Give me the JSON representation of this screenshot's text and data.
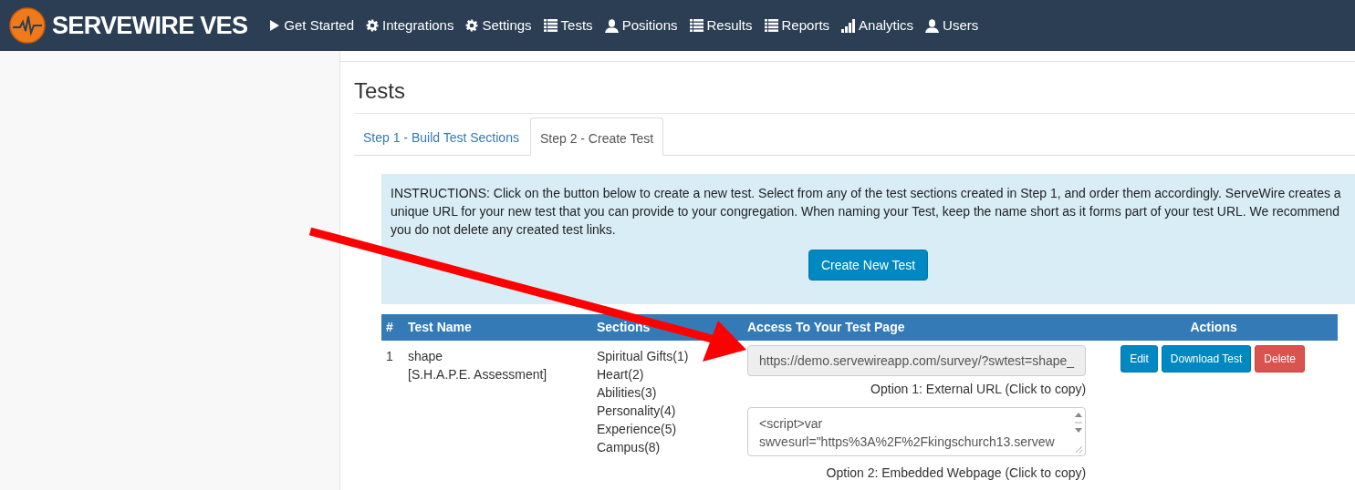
{
  "navbar": {
    "brand": "SERVEWIRE VES",
    "items": [
      {
        "label": "Get Started",
        "kind": "play"
      },
      {
        "label": "Integrations",
        "kind": "gear"
      },
      {
        "label": "Settings",
        "kind": "gear"
      },
      {
        "label": "Tests",
        "kind": "list"
      },
      {
        "label": "Positions",
        "kind": "user"
      },
      {
        "label": "Results",
        "kind": "list"
      },
      {
        "label": "Reports",
        "kind": "list"
      },
      {
        "label": "Analytics",
        "kind": "bars"
      },
      {
        "label": "Users",
        "kind": "user"
      }
    ]
  },
  "page": {
    "title": "Tests",
    "tabs": [
      {
        "label": "Step 1 - Build Test Sections",
        "selected": false
      },
      {
        "label": "Step 2 - Create Test",
        "selected": true
      }
    ],
    "instructions": "INSTRUCTIONS: Click on the button below to create a new test. Select from any of the test sections created in Step 1, and order them accordingly. ServeWire creates a unique URL for your new test that you can provide to your congregation. When naming your Test, keep the name short as it forms part of your test URL. We recommend you do not delete any created test links.",
    "create_button": "Create New Test",
    "table": {
      "columns": [
        "#",
        "Test Name",
        "Sections",
        "Access To Your Test Page",
        "Actions"
      ],
      "rows": [
        {
          "number": "1",
          "name": "shape",
          "full_name": "[S.H.A.P.E. Assessment]",
          "sections": [
            "Spiritual Gifts(1)",
            "Heart(2)",
            "Abilities(3)",
            "Personality(4)",
            "Experience(5)",
            "Campus(8)"
          ],
          "url": "https://demo.servewireapp.com/survey/?swtest=shape_",
          "url_caption": "Option 1: External URL (Click to copy)",
          "embed_lines": [
            "<script>var",
            "swvesurl=\"https%3A%2F%2Fkingschurch13.servew"
          ],
          "embed_caption": "Option 2: Embedded Webpage (Click to copy)",
          "actions": [
            {
              "label": "Edit",
              "kind": "primary"
            },
            {
              "label": "Download Test",
              "kind": "primary"
            },
            {
              "label": "Delete",
              "kind": "danger"
            }
          ]
        }
      ]
    }
  }
}
